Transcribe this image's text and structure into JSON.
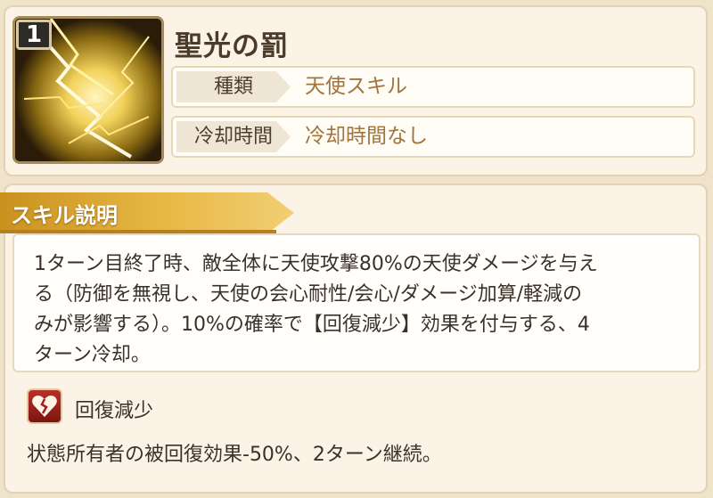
{
  "skill": {
    "rank": "1",
    "name": "聖光の罰",
    "icon": "holy-lightning-icon"
  },
  "info": [
    {
      "label": "種類",
      "value": "天使スキル"
    },
    {
      "label": "冷却時間",
      "value": "冷却時間なし"
    }
  ],
  "description": {
    "section_title": "スキル説明",
    "lines": [
      "1ターン目終了時、敵全体に天使攻撃80%の天使ダメージを与え",
      "る（防御を無視し、天使の会心耐性/会心/ダメージ加算/軽減の",
      "みが影響する）。10%の確率で【回復減少】効果を付与する、4",
      "ターン冷却。"
    ]
  },
  "effect": {
    "icon": "broken-heart-icon",
    "name": "回復減少",
    "description": "状態所有者の被回復効果-50%、2ターン継続。"
  },
  "colors": {
    "background": "#efe3cc",
    "value_text": "#a3743c",
    "banner": "#e8b744",
    "effect_icon": "#b5312a"
  }
}
